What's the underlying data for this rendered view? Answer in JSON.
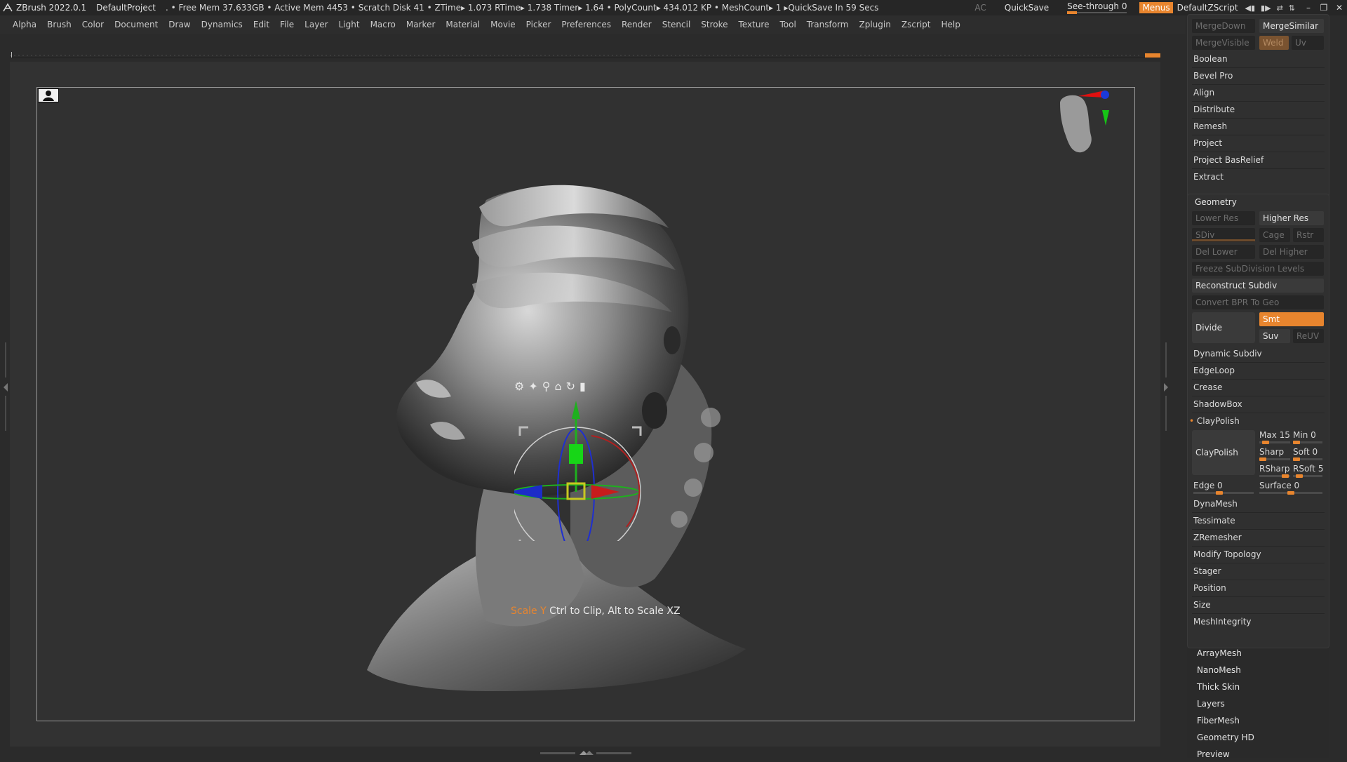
{
  "titlebar": {
    "app": "ZBrush 2022.0.1",
    "project": "DefaultProject",
    "stats": ". • Free Mem 37.633GB • Active Mem 4453 • Scratch Disk 41 •  ZTime▸ 1.073 RTime▸ 1.738 Timer▸ 1.64 • PolyCount▸ 434.012 KP  • MeshCount▸ 1   ▸QuickSave In 59 Secs",
    "ac": "AC",
    "quicksave": "QuickSave",
    "seethrough": "See-through  0",
    "menus": "Menus",
    "defaultzscript": "DefaultZScript"
  },
  "menubar": [
    "Alpha",
    "Brush",
    "Color",
    "Document",
    "Draw",
    "Dynamics",
    "Edit",
    "File",
    "Layer",
    "Light",
    "Macro",
    "Marker",
    "Material",
    "Movie",
    "Picker",
    "Preferences",
    "Render",
    "Stencil",
    "Stroke",
    "Texture",
    "Tool",
    "Transform",
    "Zplugin",
    "Zscript",
    "Help"
  ],
  "viewport": {
    "hint_highlight": "Scale Y",
    "hint_rest": " Ctrl to Clip, Alt to Scale XZ"
  },
  "palette": {
    "merge": {
      "mergedown": "MergeDown",
      "mergesimilar": "MergeSimilar",
      "mergevisible": "MergeVisible",
      "weld": "Weld",
      "uv": "Uv"
    },
    "subtool_items": [
      "Boolean",
      "Bevel Pro",
      "Align",
      "Distribute",
      "Remesh",
      "Project",
      "Project BasRelief",
      "Extract"
    ],
    "geometry": {
      "title": "Geometry",
      "lower_res": "Lower Res",
      "higher_res": "Higher Res",
      "sdiv": "SDiv",
      "cage": "Cage",
      "rstr": "Rstr",
      "del_lower": "Del Lower",
      "del_higher": "Del Higher",
      "freeze": "Freeze SubDivision Levels",
      "reconstruct": "Reconstruct Subdiv",
      "convert_bpr": "Convert BPR To Geo",
      "divide": "Divide",
      "smt": "Smt",
      "suv": "Suv",
      "reuv": "ReUV",
      "dynamic_subdiv": "Dynamic Subdiv",
      "edgeloop": "EdgeLoop",
      "crease": "Crease",
      "shadowbox": "ShadowBox",
      "claypolish_header": "ClayPolish",
      "claypolish_btn": "ClayPolish",
      "max": "Max 15",
      "min": "Min 0",
      "sharp": "Sharp",
      "soft": "Soft 0",
      "rsharp": "RSharp",
      "rsoft": "RSoft 5",
      "edge": "Edge 0",
      "surface": "Surface 0",
      "rest": [
        "DynaMesh",
        "Tessimate",
        "ZRemesher",
        "Modify Topology",
        "Stager",
        "Position",
        "Size",
        "MeshIntegrity"
      ]
    },
    "tool_sections": [
      "ArrayMesh",
      "NanoMesh",
      "Thick Skin",
      "Layers",
      "FiberMesh",
      "Geometry HD",
      "Preview"
    ]
  },
  "colors": {
    "accent": "#e8852e",
    "background": "#2b2b2b",
    "panel": "#303030"
  },
  "icons": [
    "zbrush-logo-icon",
    "gear-icon",
    "pin-icon",
    "marker-icon",
    "home-icon",
    "rotate-icon",
    "lock-icon",
    "perspective-icon",
    "head-orientation-icon"
  ]
}
